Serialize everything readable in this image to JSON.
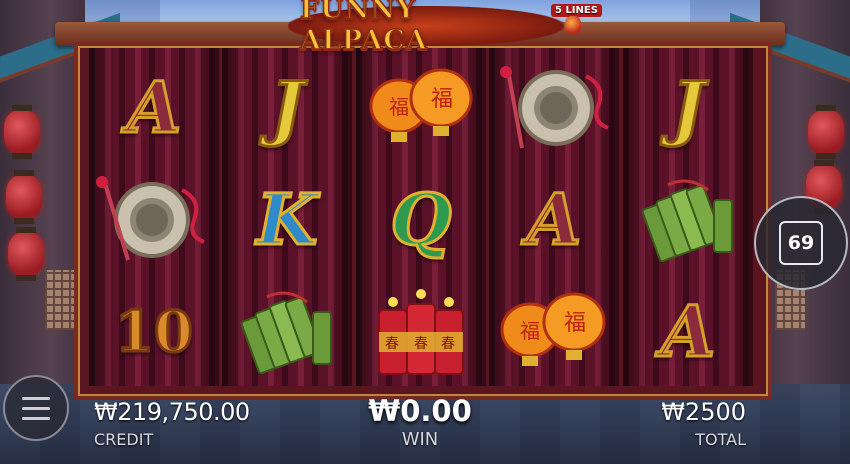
{
  "game": {
    "title": "FUNNY ALPACA",
    "lines_badge": "5 LINES"
  },
  "reels": [
    [
      "A",
      "gong",
      "10"
    ],
    [
      "J",
      "K",
      "jade-tablets"
    ],
    [
      "lanterns",
      "Q",
      "firecrackers"
    ],
    [
      "gong",
      "A",
      "lanterns"
    ],
    [
      "J",
      "jade-tablets",
      "A"
    ]
  ],
  "hud": {
    "credit_value": "₩219,750.00",
    "credit_label": "CREDIT",
    "win_value": "₩0.00",
    "win_label": "WIN",
    "total_value": "₩2500",
    "total_label": "TOTAL",
    "auto_spin_count": "69"
  },
  "colors": {
    "reel_bg": "#5b1228",
    "title_gold": "#f5c23a",
    "frame": "#7a2a20"
  },
  "icons": {
    "menu": "hamburger-icon",
    "autospin": "square-counter-icon"
  }
}
